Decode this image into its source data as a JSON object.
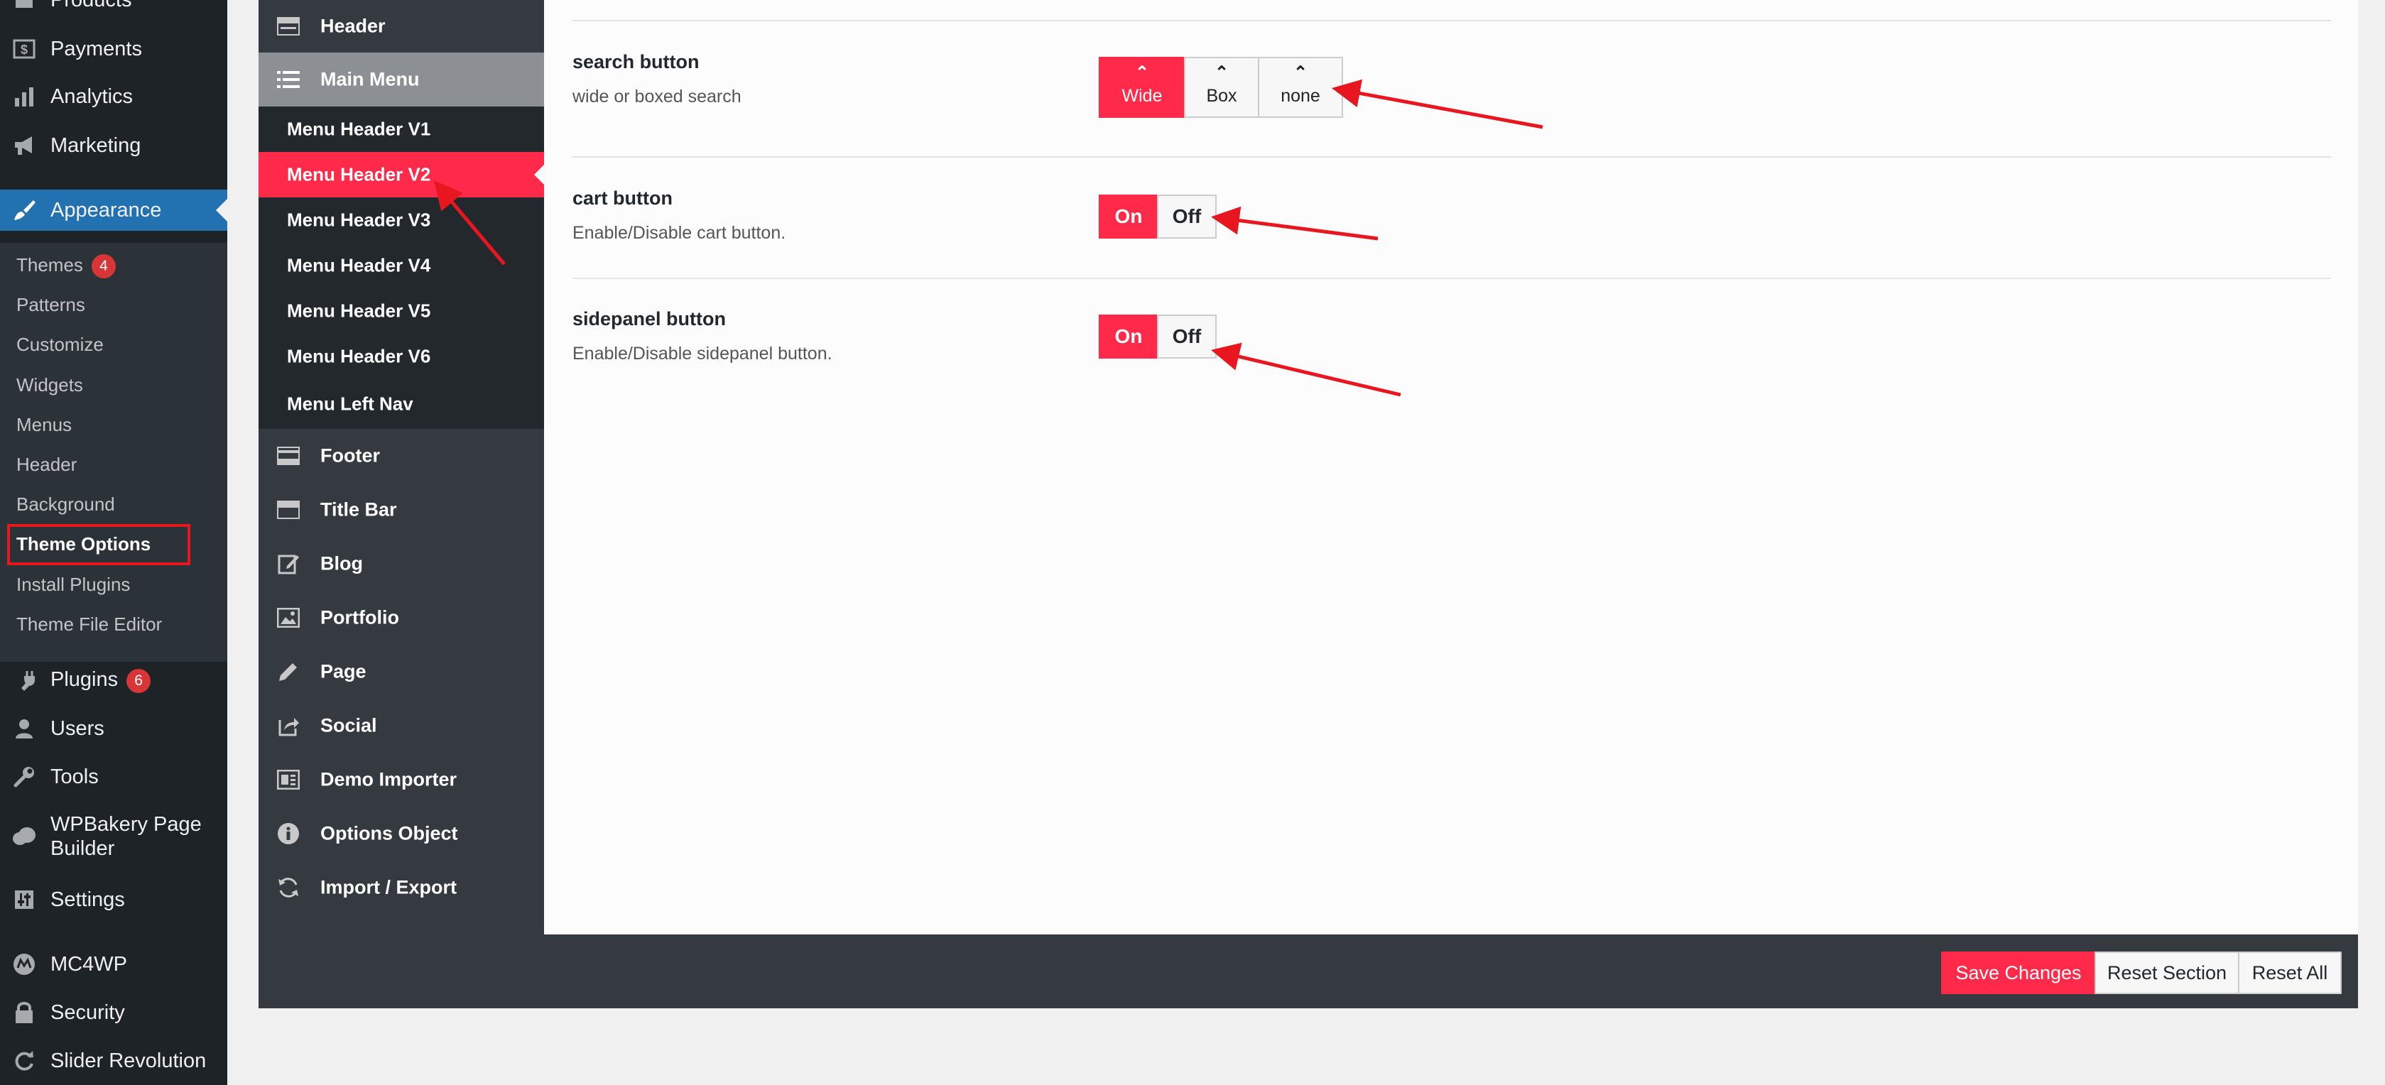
{
  "wp_sidebar": {
    "items": [
      {
        "label": "Products",
        "icon": "products-icon"
      },
      {
        "label": "Payments",
        "icon": "payments-icon"
      },
      {
        "label": "Analytics",
        "icon": "analytics-icon"
      },
      {
        "label": "Marketing",
        "icon": "megaphone-icon"
      },
      {
        "label": "Appearance",
        "icon": "paintbrush-icon",
        "active": true
      },
      {
        "label": "Plugins",
        "icon": "plug-icon",
        "badge": "6"
      },
      {
        "label": "Users",
        "icon": "user-icon"
      },
      {
        "label": "Tools",
        "icon": "wrench-icon"
      },
      {
        "label": "WPBakery Page",
        "label_line2": "Builder",
        "icon": "cloud-icon"
      },
      {
        "label": "Settings",
        "icon": "settings-icon"
      },
      {
        "label": "MC4WP",
        "icon": "mc4wp-icon"
      },
      {
        "label": "Security",
        "icon": "lock-icon"
      },
      {
        "label": "Slider Revolution",
        "icon": "refresh-icon"
      }
    ],
    "appearance_submenu": [
      {
        "label": "Themes",
        "badge": "4"
      },
      {
        "label": "Patterns"
      },
      {
        "label": "Customize"
      },
      {
        "label": "Widgets"
      },
      {
        "label": "Menus"
      },
      {
        "label": "Header"
      },
      {
        "label": "Background"
      },
      {
        "label": "Theme Options",
        "current": true
      },
      {
        "label": "Install Plugins"
      },
      {
        "label": "Theme File Editor"
      }
    ]
  },
  "redux_nav": {
    "items": [
      {
        "label": "Header",
        "icon": "header-layout-icon"
      },
      {
        "label": "Main Menu",
        "icon": "list-icon",
        "open": true
      },
      {
        "label": "Footer",
        "icon": "footer-layout-icon"
      },
      {
        "label": "Title Bar",
        "icon": "titlebar-layout-icon"
      },
      {
        "label": "Blog",
        "icon": "edit-icon"
      },
      {
        "label": "Portfolio",
        "icon": "image-icon"
      },
      {
        "label": "Page",
        "icon": "pencil-icon"
      },
      {
        "label": "Social",
        "icon": "share-icon"
      },
      {
        "label": "Demo Importer",
        "icon": "demo-importer-icon"
      },
      {
        "label": "Options Object",
        "icon": "info-icon"
      },
      {
        "label": "Import / Export",
        "icon": "refresh-icon"
      }
    ],
    "main_menu_sub": [
      {
        "label": "Menu Header V1"
      },
      {
        "label": "Menu Header V2",
        "active": true
      },
      {
        "label": "Menu Header V3"
      },
      {
        "label": "Menu Header V4"
      },
      {
        "label": "Menu Header V5"
      },
      {
        "label": "Menu Header V6"
      },
      {
        "label": "Menu Left Nav"
      }
    ]
  },
  "options": {
    "search_button": {
      "title": "search button",
      "desc": "wide or boxed search",
      "choices": [
        {
          "label": "Wide",
          "selected": true
        },
        {
          "label": "Box"
        },
        {
          "label": "none"
        }
      ]
    },
    "cart_button": {
      "title": "cart button",
      "desc": "Enable/Disable cart button.",
      "on_label": "On",
      "off_label": "Off",
      "value": "On"
    },
    "sidepanel_button": {
      "title": "sidepanel button",
      "desc": "Enable/Disable sidepanel button.",
      "on_label": "On",
      "off_label": "Off",
      "value": "On"
    }
  },
  "footer": {
    "save": "Save Changes",
    "reset_section": "Reset Section",
    "reset_all": "Reset All"
  },
  "colors": {
    "accent": "#ff2a4a",
    "wp_active": "#2271b1",
    "annotation": "#e8171f"
  }
}
